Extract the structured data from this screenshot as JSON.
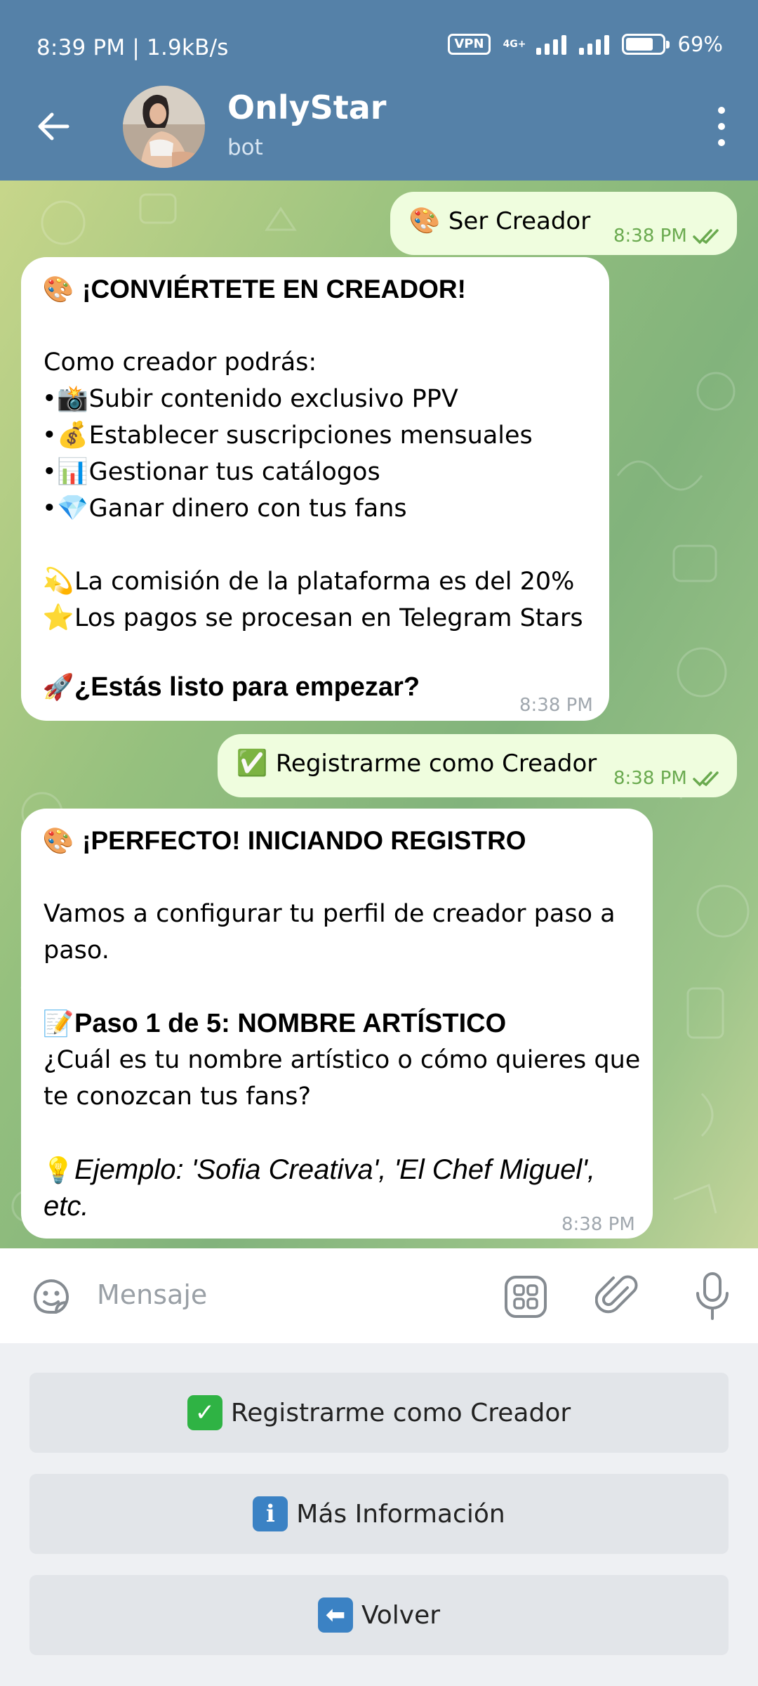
{
  "status_bar": {
    "time_speed": "8:39 PM | 1.9kB/s",
    "vpn": "VPN",
    "network": "4G+",
    "battery": "69%"
  },
  "header": {
    "title": "OnlyStar",
    "subtitle": "bot"
  },
  "messages": {
    "out1": {
      "emoji": "🎨",
      "text": "Ser Creador",
      "time": "8:38 PM"
    },
    "in1": {
      "title_emoji": "🎨",
      "title": "¡CONVIÉRTETE EN CREADOR!",
      "intro": "Como creador podrás:",
      "bullets": [
        {
          "emoji": "📸",
          "text": "Subir contenido exclusivo PPV"
        },
        {
          "emoji": "💰",
          "text": "Establecer suscripciones mensuales"
        },
        {
          "emoji": "📊",
          "text": "Gestionar tus catálogos"
        },
        {
          "emoji": "💎",
          "text": "Ganar dinero con tus fans"
        }
      ],
      "note1_emoji": "💫",
      "note1": "La comisión de la plataforma es del 20%",
      "note2_emoji": "⭐",
      "note2": "Los pagos se procesan en Telegram Stars",
      "cta_emoji": "🚀",
      "cta": "¿Estás listo para empezar?",
      "time": "8:38 PM"
    },
    "out2": {
      "emoji": "✅",
      "text": "Registrarme como Creador",
      "time": "8:38 PM"
    },
    "in2": {
      "title_emoji": "🎨",
      "title": "¡PERFECTO! INICIANDO REGISTRO",
      "p1_line1": "Vamos a configurar tu perfil de creador paso a",
      "p1_line2": "paso.",
      "step_emoji": "📝",
      "step": "Paso 1 de 5: NOMBRE ARTÍSTICO",
      "q_line1": "¿Cuál es tu nombre artístico o cómo quieres que",
      "q_line2": "te conozcan tus fans?",
      "example_emoji": "💡",
      "example_line1": "Ejemplo: 'Sofia Creativa', 'El Chef Miguel',",
      "example_line2": "etc.",
      "time": "8:38 PM"
    }
  },
  "input": {
    "placeholder": "Mensaje"
  },
  "keyboard": {
    "buttons": [
      {
        "icon": "✓",
        "label": "Registrarme como Creador",
        "color": "#2fb344"
      },
      {
        "icon": "i",
        "label": "Más Información",
        "color": "#3b82c4"
      },
      {
        "icon": "⬅",
        "label": "Volver",
        "color": "#3b82c4"
      }
    ]
  }
}
